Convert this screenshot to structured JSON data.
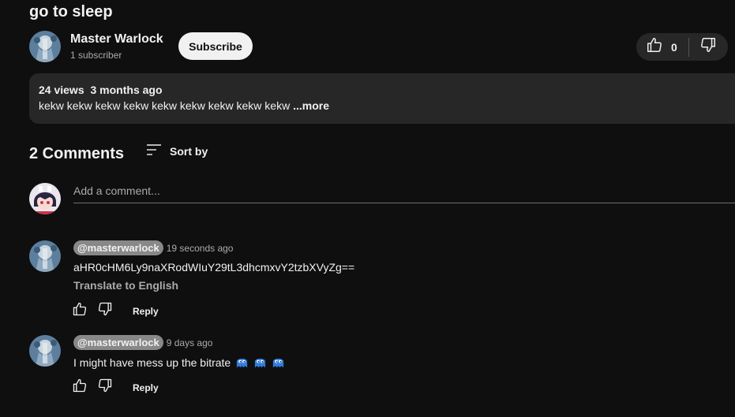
{
  "video": {
    "title": "go to sleep",
    "channel_name": "Master Warlock",
    "subscribers": "1 subscriber",
    "subscribe_label": "Subscribe",
    "like_count": "0"
  },
  "description": {
    "views": "24 views",
    "date": "3 months ago",
    "text": "kekw kekw kekw kekw kekw kekw kekw kekw kekw",
    "more_label": "...more"
  },
  "comments_section": {
    "count_label": "2 Comments",
    "sort_label": "Sort by",
    "add_placeholder": "Add a comment..."
  },
  "comments": [
    {
      "handle": "@masterwarlock",
      "time": "19 seconds ago",
      "text": "aHR0cHM6Ly9naXRodWIuY29tL3dhcmxvY2tzbXVyZg==",
      "translate_label": "Translate to English",
      "reply_label": "Reply"
    },
    {
      "handle": "@masterwarlock",
      "time": "9 days ago",
      "text": "I might have mess up the bitrate",
      "emojis": [
        "blue-ghost-emoji",
        "blue-ghost-emoji",
        "blue-ghost-emoji"
      ],
      "reply_label": "Reply"
    }
  ],
  "icons": {
    "like": "thumbs-up-icon",
    "dislike": "thumbs-down-icon",
    "sort": "sort-lines-icon"
  },
  "colors": {
    "background": "#0f0f0f",
    "panel": "#272727",
    "text": "#f1f1f1",
    "muted": "#aaaaaa",
    "handle_badge": "#888888",
    "emoji_blue": "#2f7de1"
  }
}
